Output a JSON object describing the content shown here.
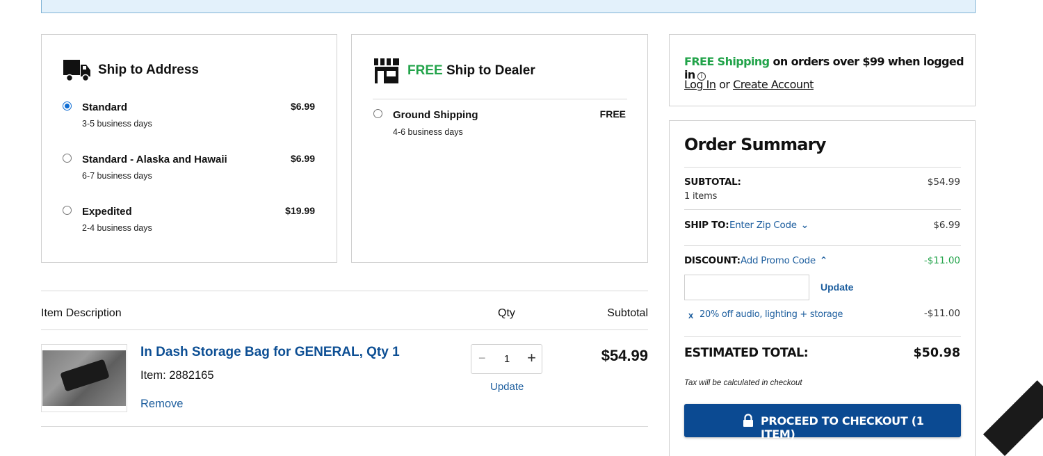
{
  "ship_address": {
    "title": "Ship to Address",
    "icon": "truck-icon",
    "options": [
      {
        "name": "Standard",
        "days": "3-5 business days",
        "price": "$6.99",
        "selected": true
      },
      {
        "name": "Standard - Alaska and Hawaii",
        "days": "6-7 business days",
        "price": "$6.99",
        "selected": false
      },
      {
        "name": "Expedited",
        "days": "2-4 business days",
        "price": "$19.99",
        "selected": false
      }
    ]
  },
  "ship_dealer": {
    "title_free": "FREE",
    "title_rest": " Ship to Dealer",
    "icon": "store-icon",
    "option": {
      "name": "Ground Shipping",
      "days": "4-6 business days",
      "price": "FREE"
    }
  },
  "cart": {
    "headers": {
      "description": "Item Description",
      "qty": "Qty",
      "subtotal": "Subtotal"
    },
    "item": {
      "name": "In Dash Storage Bag for GENERAL, Qty 1",
      "item_no": "Item: 2882165",
      "remove": "Remove",
      "qty": "1",
      "qty_minus": "−",
      "qty_plus": "+",
      "update": "Update",
      "subtotal": "$54.99"
    }
  },
  "promo_banner": {
    "free_shipping": "FREE Shipping",
    "rest": " on orders over $99 when logged in",
    "info_icon": "i",
    "login": "Log In",
    "or": " or ",
    "create_account": "Create Account"
  },
  "order_summary": {
    "title": "Order Summary",
    "subtotal_label": "SUBTOTAL:",
    "subtotal_items": "1 items",
    "subtotal_value": "$54.99",
    "ship_label": "SHIP TO:",
    "ship_link": "Enter Zip Code",
    "ship_value": "$6.99",
    "discount_label": "DISCOUNT:",
    "discount_link": "Add Promo Code",
    "discount_value": "-$11.00",
    "promo_update": "Update",
    "coupon_remove": "x",
    "coupon_text": "20% off audio, lighting + storage",
    "coupon_value": "-$11.00",
    "estimated_label": "ESTIMATED TOTAL:",
    "estimated_value": "$50.98",
    "tax_note": "Tax will be calculated in checkout",
    "checkout_label": "PROCEED TO CHECKOUT (1 ITEM)"
  },
  "colors": {
    "accent_green": "#22a34a",
    "link_blue": "#1d5e9e",
    "checkout_blue": "#0b4a92",
    "banner_bg": "#e3f1fb"
  },
  "feedback": "back"
}
